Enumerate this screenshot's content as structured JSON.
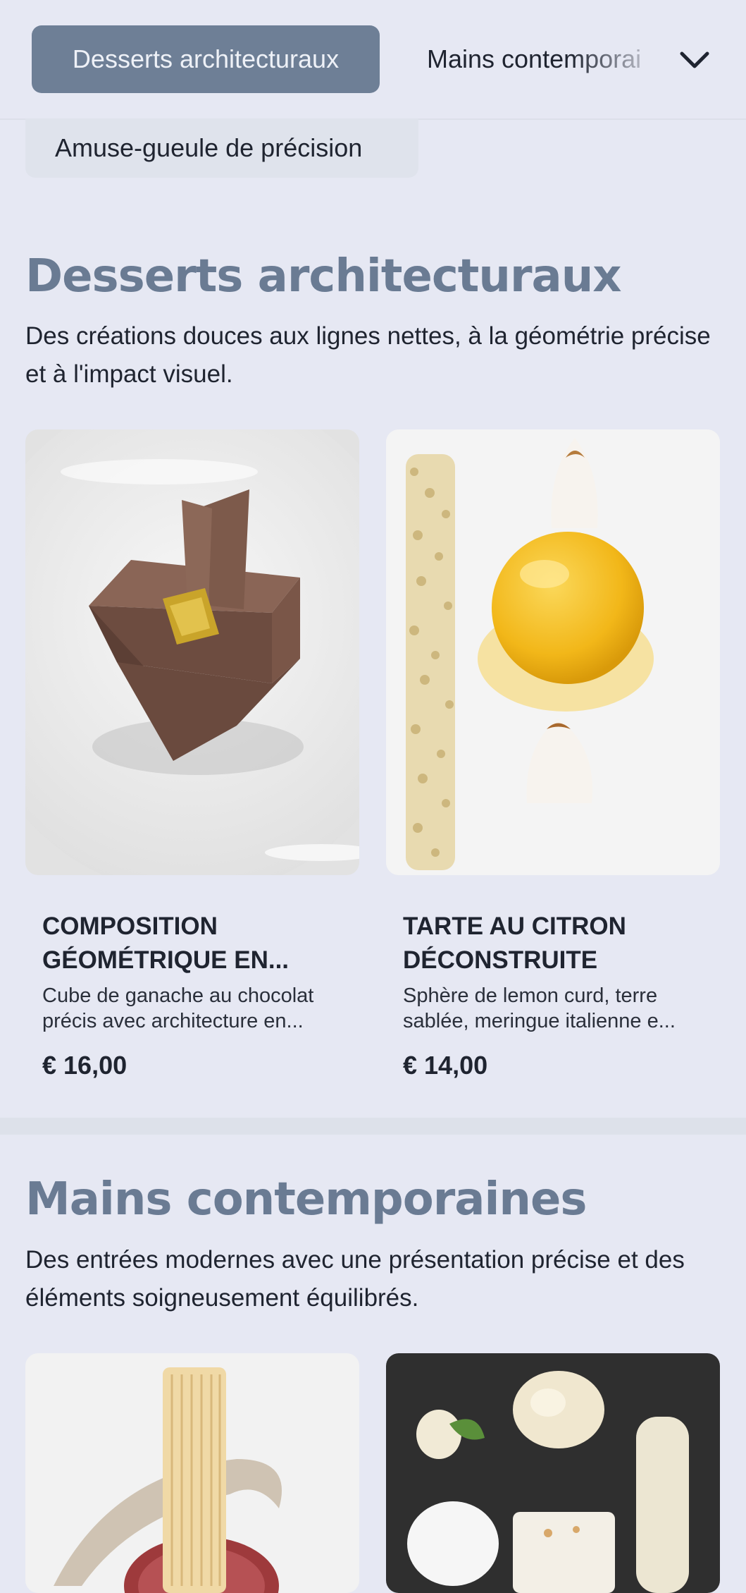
{
  "nav": {
    "active_tab": "Desserts architecturaux",
    "next_tab": "Mains contemporai",
    "second_row_tab": "Amuse-gueule de précision",
    "expand_icon": "chevron-down-icon"
  },
  "sections": [
    {
      "title": "Desserts architecturaux",
      "description": "Des créations douces aux lignes nettes, à la géométrie précise et à l'impact visuel.",
      "items": [
        {
          "name": "COMPOSITION GÉOMÉTRIQUE EN...",
          "description": "Cube de ganache au chocolat précis avec architecture en...",
          "price": "€ 16,00"
        },
        {
          "name": "TARTE AU CITRON DÉCONSTRUITE",
          "description": "Sphère de lemon curd, terre sablée, meringue italienne e...",
          "price": "€ 14,00"
        }
      ]
    },
    {
      "title": "Mains contemporaines",
      "description": "Des entrées modernes avec une présentation précise et des éléments soigneusement équilibrés."
    }
  ],
  "colors": {
    "background": "#e6e8f3",
    "accent": "#6e7f96",
    "title": "#6a7b93"
  }
}
